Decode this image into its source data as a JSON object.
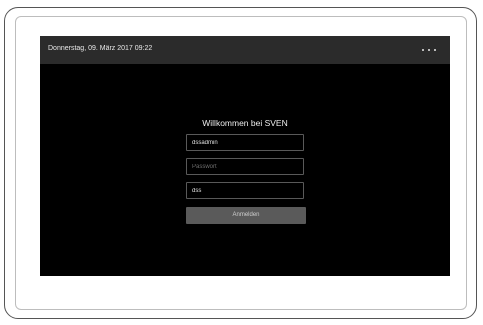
{
  "statusbar": {
    "datetime": "Donnerstag, 09. März 2017 09:22",
    "menu_icon": "more-dots-icon"
  },
  "login": {
    "title": "Willkommen bei SVEN",
    "username_value": "dssadmin",
    "password_placeholder": "Passwort",
    "domain_value": "dss",
    "submit_label": "Anmelden"
  }
}
